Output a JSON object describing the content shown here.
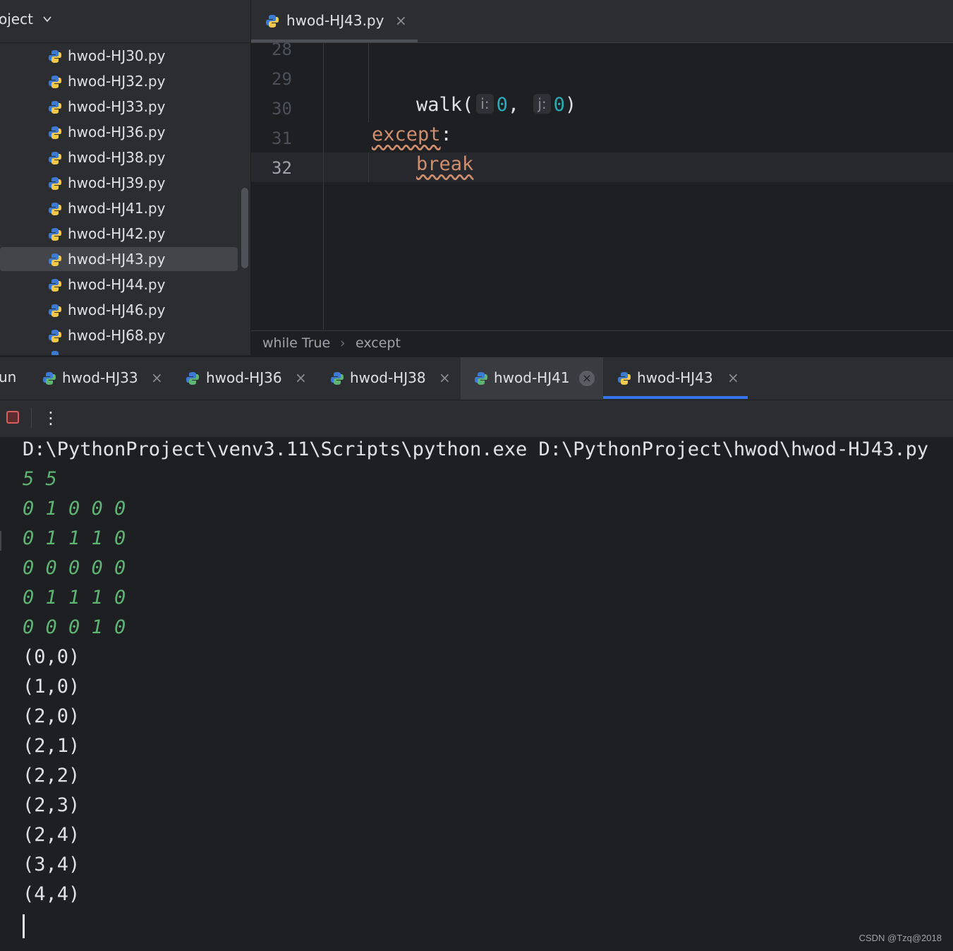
{
  "project": {
    "title": "oject",
    "files": [
      "hwod-HJ30.py",
      "hwod-HJ32.py",
      "hwod-HJ33.py",
      "hwod-HJ36.py",
      "hwod-HJ38.py",
      "hwod-HJ39.py",
      "hwod-HJ41.py",
      "hwod-HJ42.py",
      "hwod-HJ43.py",
      "hwod-HJ44.py",
      "hwod-HJ46.py",
      "hwod-HJ68.py"
    ],
    "selected_file": "hwod-HJ43.py"
  },
  "editor": {
    "tab_label": "hwod-HJ43.py",
    "close_glyph": "×",
    "line_numbers": [
      "28",
      "29",
      "30",
      "31",
      "32"
    ],
    "current_line": "32",
    "code": {
      "walk_fn": "walk(",
      "hint_i": "i:",
      "arg_i": "0",
      "comma": ", ",
      "hint_j": "j:",
      "arg_j": "0",
      "close_paren": ")",
      "except_kw": "except",
      "colon": ":",
      "break_kw": "break"
    },
    "breadcrumb": [
      "while True",
      "except"
    ],
    "breadcrumb_sep": "›"
  },
  "run": {
    "label": "un",
    "tabs": [
      "hwod-HJ33",
      "hwod-HJ36",
      "hwod-HJ38",
      "hwod-HJ41",
      "hwod-HJ43"
    ],
    "active_tab": "hwod-HJ43",
    "hovered_tab": "hwod-HJ41",
    "close_glyph": "×",
    "more_glyph": "⋮"
  },
  "console": {
    "command": "D:\\PythonProject\\venv3.11\\Scripts\\python.exe D:\\PythonProject\\hwod\\hwod-HJ43.py",
    "input_lines": [
      "5 5",
      "0 1 0 0 0",
      "0 1 1 1 0",
      "0 0 0 0 0",
      "0 1 1 1 0",
      "0 0 0 1 0"
    ],
    "output_lines": [
      "(0,0)",
      "(1,0)",
      "(2,0)",
      "(2,1)",
      "(2,2)",
      "(2,3)",
      "(2,4)",
      "(3,4)",
      "(4,4)"
    ]
  },
  "watermark": "CSDN @Tzq@2018",
  "colors": {
    "accent": "#3574f0",
    "keyword": "#cf8e6d",
    "number": "#2aacb8",
    "input_text": "#5fb373",
    "stop": "#db5c5c"
  }
}
